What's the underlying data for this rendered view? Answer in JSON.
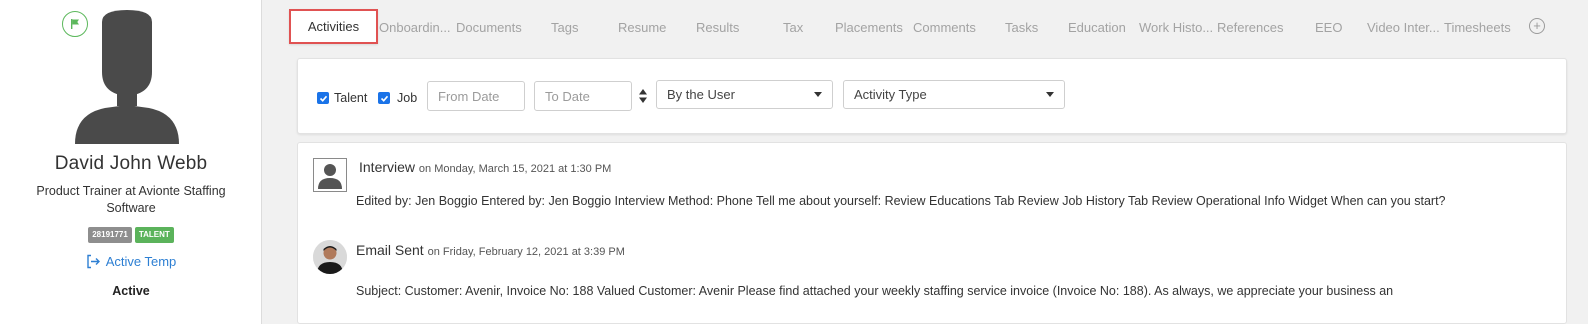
{
  "profile": {
    "name": "David John Webb",
    "title": "Product Trainer at Avionte Staffing Software",
    "id_badge": "28191771",
    "type_badge": "TALENT",
    "status_link": "Active Temp",
    "status": "Active"
  },
  "tabs": [
    {
      "label": "Activities",
      "active": true
    },
    {
      "label": "Onboardin..."
    },
    {
      "label": "Documents"
    },
    {
      "label": "Tags"
    },
    {
      "label": "Resume"
    },
    {
      "label": "Results"
    },
    {
      "label": "Tax"
    },
    {
      "label": "Placements"
    },
    {
      "label": "Comments"
    },
    {
      "label": "Tasks"
    },
    {
      "label": "Education"
    },
    {
      "label": "Work Histo..."
    },
    {
      "label": "References"
    },
    {
      "label": "EEO"
    },
    {
      "label": "Video Inter..."
    },
    {
      "label": "Timesheets"
    }
  ],
  "filters": {
    "talent_label": "Talent",
    "talent_checked": true,
    "job_label": "Job",
    "job_checked": true,
    "from_placeholder": "From Date",
    "to_placeholder": "To Date",
    "user_select": "By the User",
    "type_select": "Activity Type"
  },
  "activities": [
    {
      "title": "Interview",
      "date": "on Monday, March 15, 2021 at 1:30 PM",
      "body": "Edited by: Jen Boggio Entered by: Jen Boggio Interview Method: Phone Tell me about yourself: Review Educations Tab Review Job History Tab Review Operational Info Widget When can you start?"
    },
    {
      "title": "Email Sent",
      "date": "on Friday, February 12, 2021 at 3:39 PM",
      "body": "Subject: Customer: Avenir, Invoice No: 188 Valued Customer: Avenir Please find attached your weekly staffing service invoice (Invoice No: 188). As always, we appreciate your business an"
    }
  ],
  "colors": {
    "accent_green": "#5bb35b",
    "link_blue": "#2d7fd3",
    "active_tab_border": "#e05252"
  }
}
